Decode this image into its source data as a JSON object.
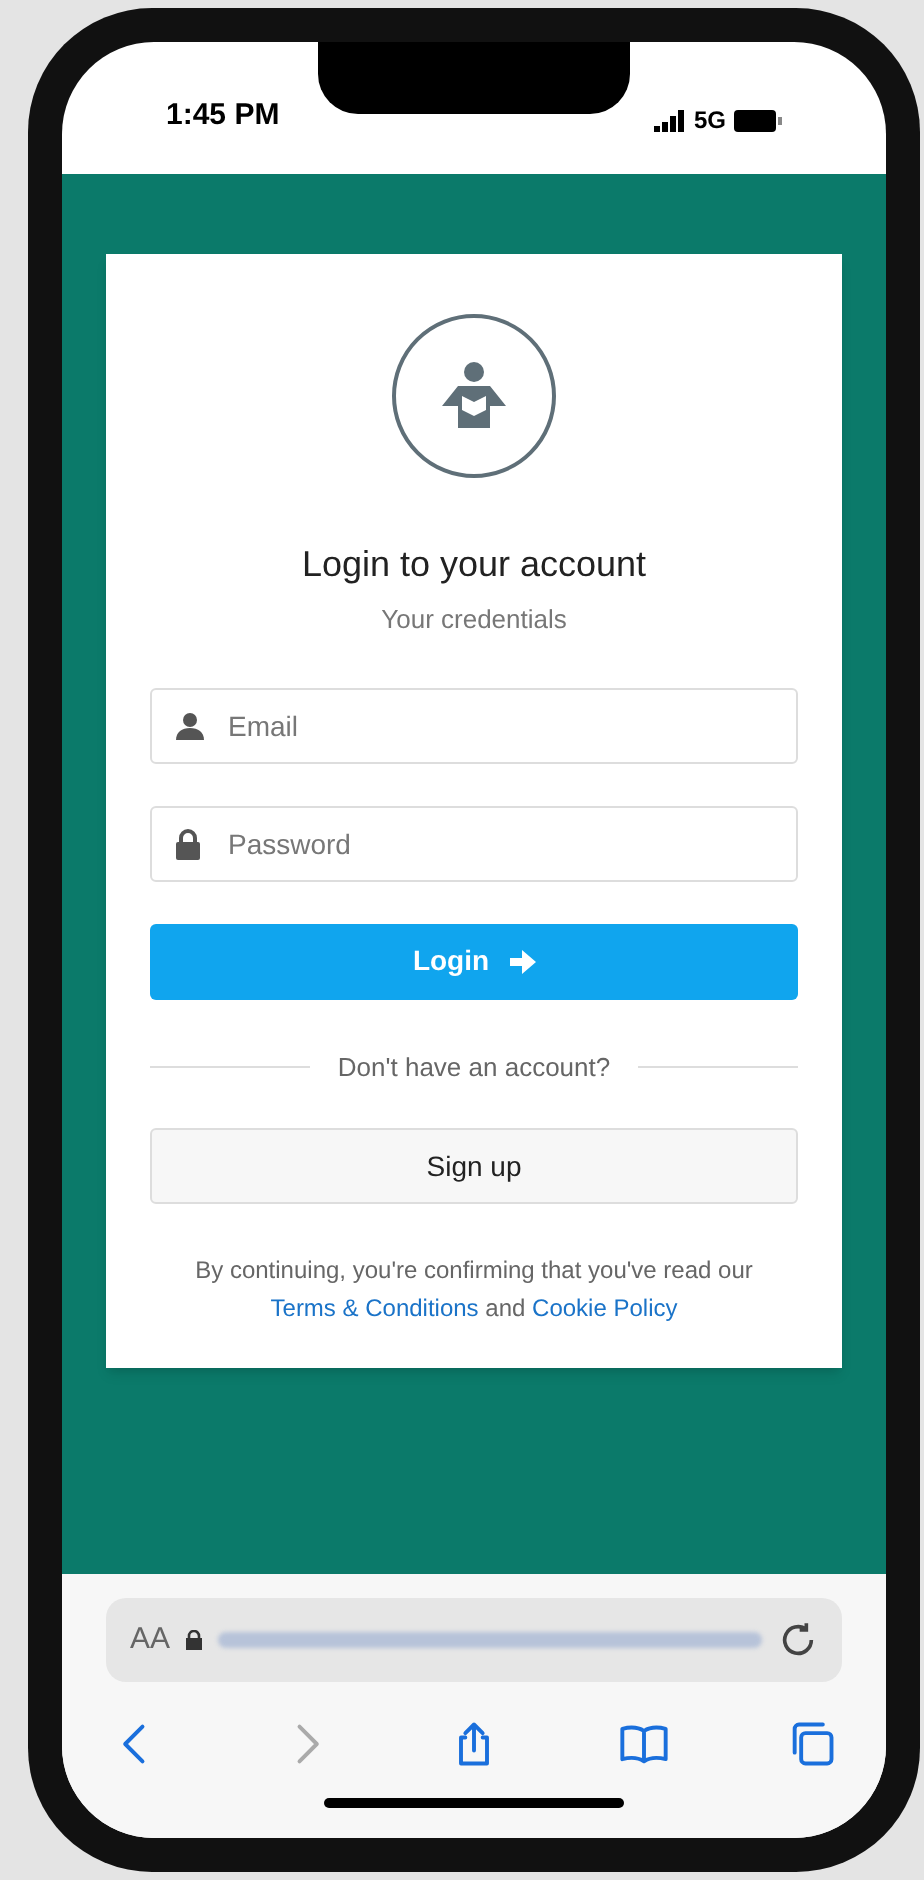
{
  "status_bar": {
    "time": "1:45 PM",
    "network": "5G"
  },
  "login_card": {
    "title": "Login to your account",
    "subtitle": "Your credentials",
    "fields": [
      {
        "kind": "email",
        "placeholder": "Email"
      },
      {
        "kind": "password",
        "placeholder": "Password"
      }
    ],
    "login_button": "Login",
    "divider_text": "Don't have an account?",
    "signup_button": "Sign up",
    "legal_text": "By continuing, you're confirming that you've read our",
    "terms_link": "Terms & Conditions",
    "joiner": "and",
    "cookie_link": "Cookie Policy"
  },
  "browser_bar": {
    "text_size_button": "AA",
    "nav": [
      {
        "kind": "back",
        "disabled": false
      },
      {
        "kind": "forward",
        "disabled": true
      },
      {
        "kind": "share",
        "disabled": false
      },
      {
        "kind": "bookmarks",
        "disabled": false
      },
      {
        "kind": "tabs",
        "disabled": false
      }
    ]
  }
}
